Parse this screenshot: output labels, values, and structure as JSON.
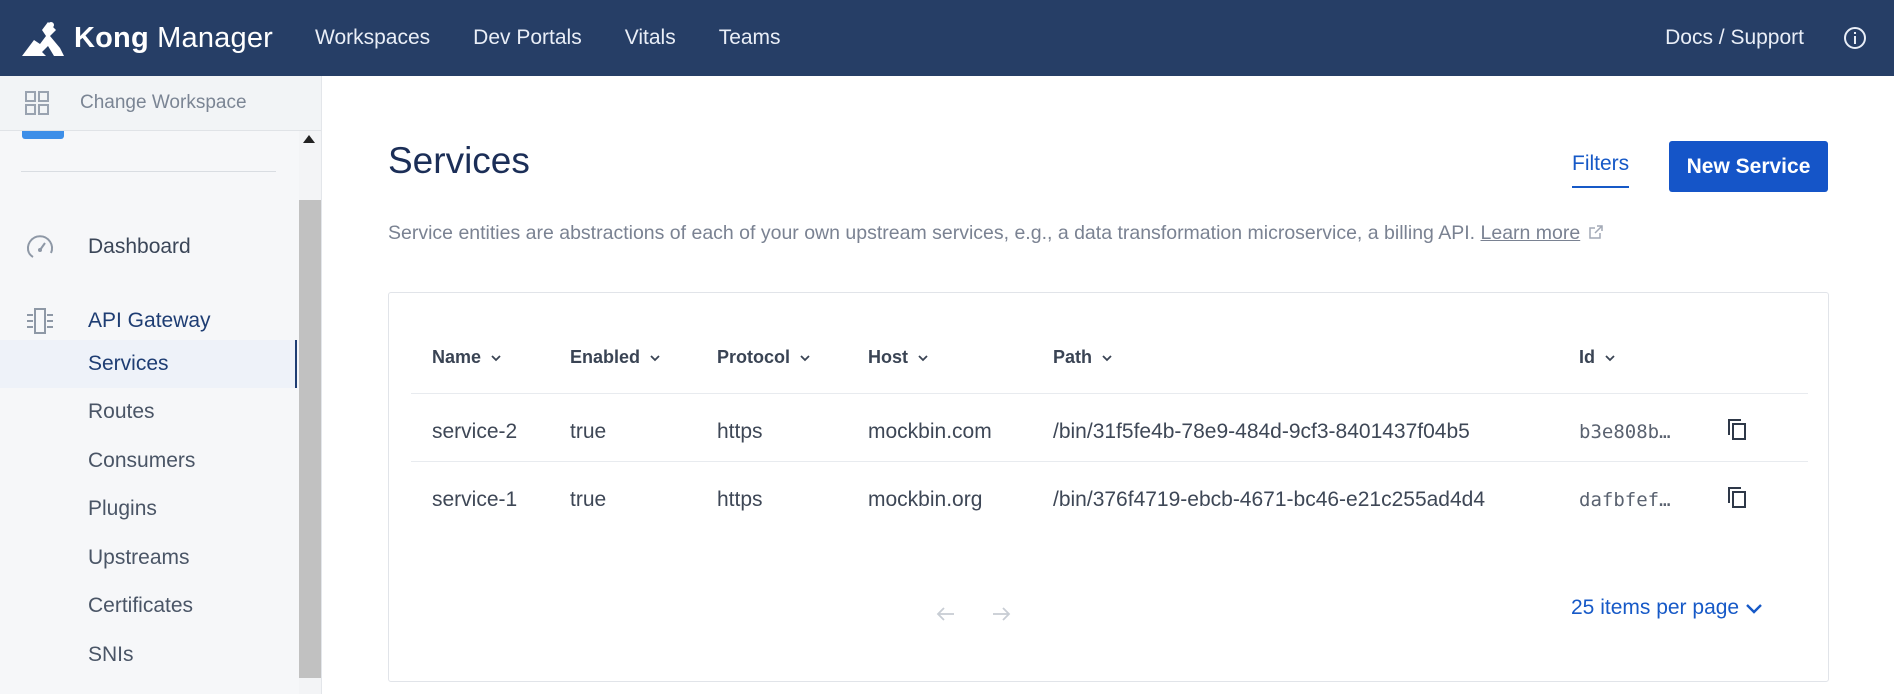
{
  "topbar": {
    "brand_bold": "Kong",
    "brand_light": "Manager",
    "nav": [
      "Workspaces",
      "Dev Portals",
      "Vitals",
      "Teams"
    ],
    "docs_support": "Docs / Support"
  },
  "sidebar": {
    "change_workspace": "Change Workspace",
    "dashboard": "Dashboard",
    "api_gateway": "API Gateway",
    "items": [
      "Services",
      "Routes",
      "Consumers",
      "Plugins",
      "Upstreams",
      "Certificates",
      "SNIs"
    ],
    "active_item": "Services"
  },
  "main": {
    "title": "Services",
    "filters_label": "Filters",
    "new_service_label": "New Service",
    "description": "Service entities are abstractions of each of your own upstream services, e.g., a data transformation microservice, a billing API.",
    "learn_more": "Learn more",
    "table": {
      "headers": [
        "Name",
        "Enabled",
        "Protocol",
        "Host",
        "Path",
        "Id"
      ],
      "rows": [
        [
          "service-2",
          "true",
          "https",
          "mockbin.com",
          "/bin/31f5fe4b-78e9-484d-9cf3-8401437f04b5",
          "b3e808b…"
        ],
        [
          "service-1",
          "true",
          "https",
          "mockbin.org",
          "/bin/376f4719-ebcb-4671-bc46-e21c255ad4d4",
          "dafbfef…"
        ]
      ]
    },
    "per_page": "25 items per page"
  },
  "colors": {
    "topbar_bg": "#263e66",
    "primary": "#1555c8",
    "title": "#1b2e57"
  }
}
